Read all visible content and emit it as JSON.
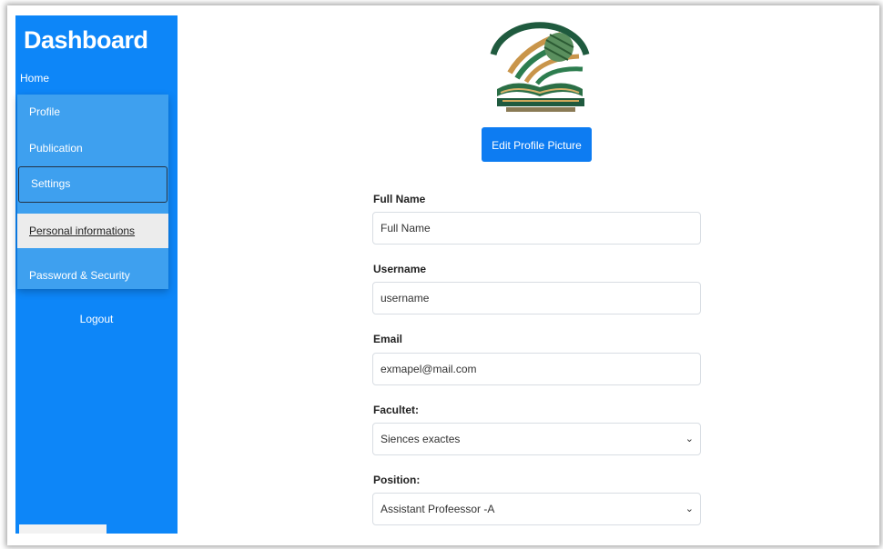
{
  "sidebar": {
    "brand": "Dashboard",
    "home": "Home",
    "items": [
      {
        "label": "Profile"
      },
      {
        "label": "Publication"
      },
      {
        "label": "Settings"
      },
      {
        "label": "Personal informations"
      },
      {
        "label": "Password & Security"
      }
    ],
    "logout": "Logout",
    "accent_color": "#0d86f8"
  },
  "profile": {
    "logo_icon": "university-book-logo-icon",
    "edit_picture_label": "Edit Profile Picture"
  },
  "form": {
    "full_name": {
      "label": "Full Name",
      "value": "Full Name"
    },
    "username": {
      "label": "Username",
      "value": "username"
    },
    "email": {
      "label": "Email",
      "value": "exmapel@mail.com"
    },
    "facultet": {
      "label": "Facultet:",
      "selected": "Siences exactes"
    },
    "position": {
      "label": "Position:",
      "selected": "Assistant Profeessor -A"
    }
  }
}
